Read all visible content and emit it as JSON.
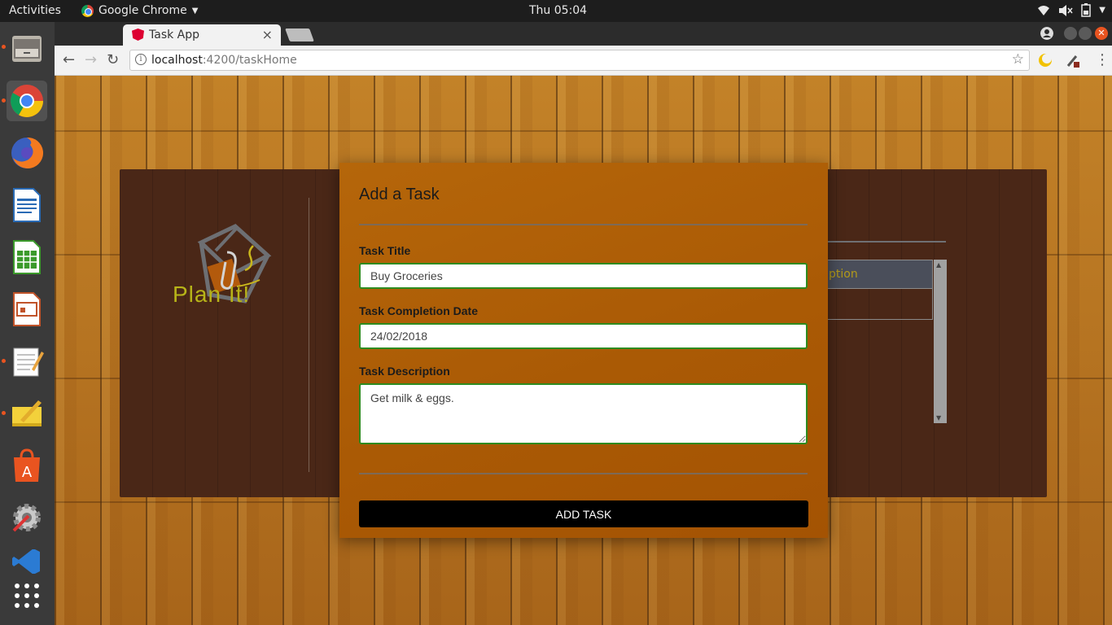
{
  "topbar": {
    "activities": "Activities",
    "app_name": "Google Chrome",
    "clock": "Thu 05:04"
  },
  "dock": {
    "items": [
      {
        "name": "files",
        "icon": "file-cabinet-icon"
      },
      {
        "name": "chrome",
        "icon": "chrome-icon"
      },
      {
        "name": "firefox",
        "icon": "firefox-icon"
      },
      {
        "name": "writer",
        "icon": "document-icon"
      },
      {
        "name": "calc",
        "icon": "spreadsheet-icon"
      },
      {
        "name": "impress",
        "icon": "presentation-icon"
      },
      {
        "name": "text-editor",
        "icon": "notepad-icon"
      },
      {
        "name": "notes",
        "icon": "sticky-note-icon"
      },
      {
        "name": "software",
        "icon": "shopping-bag-icon"
      },
      {
        "name": "settings",
        "icon": "tools-icon"
      },
      {
        "name": "vscode",
        "icon": "vscode-icon"
      },
      {
        "name": "apps",
        "icon": "app-grid-icon"
      }
    ]
  },
  "browser": {
    "tab_title": "Task App",
    "tab_close": "×",
    "url_host": "localhost",
    "url_rest": ":4200/taskHome"
  },
  "page": {
    "logo_text": "Plan It!",
    "bg_table_header_fragment": "ption"
  },
  "modal": {
    "title": "Add a Task",
    "title_label": "Task Title",
    "title_value": "Buy Groceries",
    "date_label": "Task Completion Date",
    "date_value": "24/02/2018",
    "desc_label": "Task Description",
    "desc_value": "Get milk & eggs.",
    "submit": "ADD TASK"
  },
  "colors": {
    "modal_bg": "#aa5a05",
    "input_border": "#2e8b1f",
    "button_bg": "#000000",
    "logo_text": "#b7b418",
    "board_bg": "#4a2717"
  }
}
